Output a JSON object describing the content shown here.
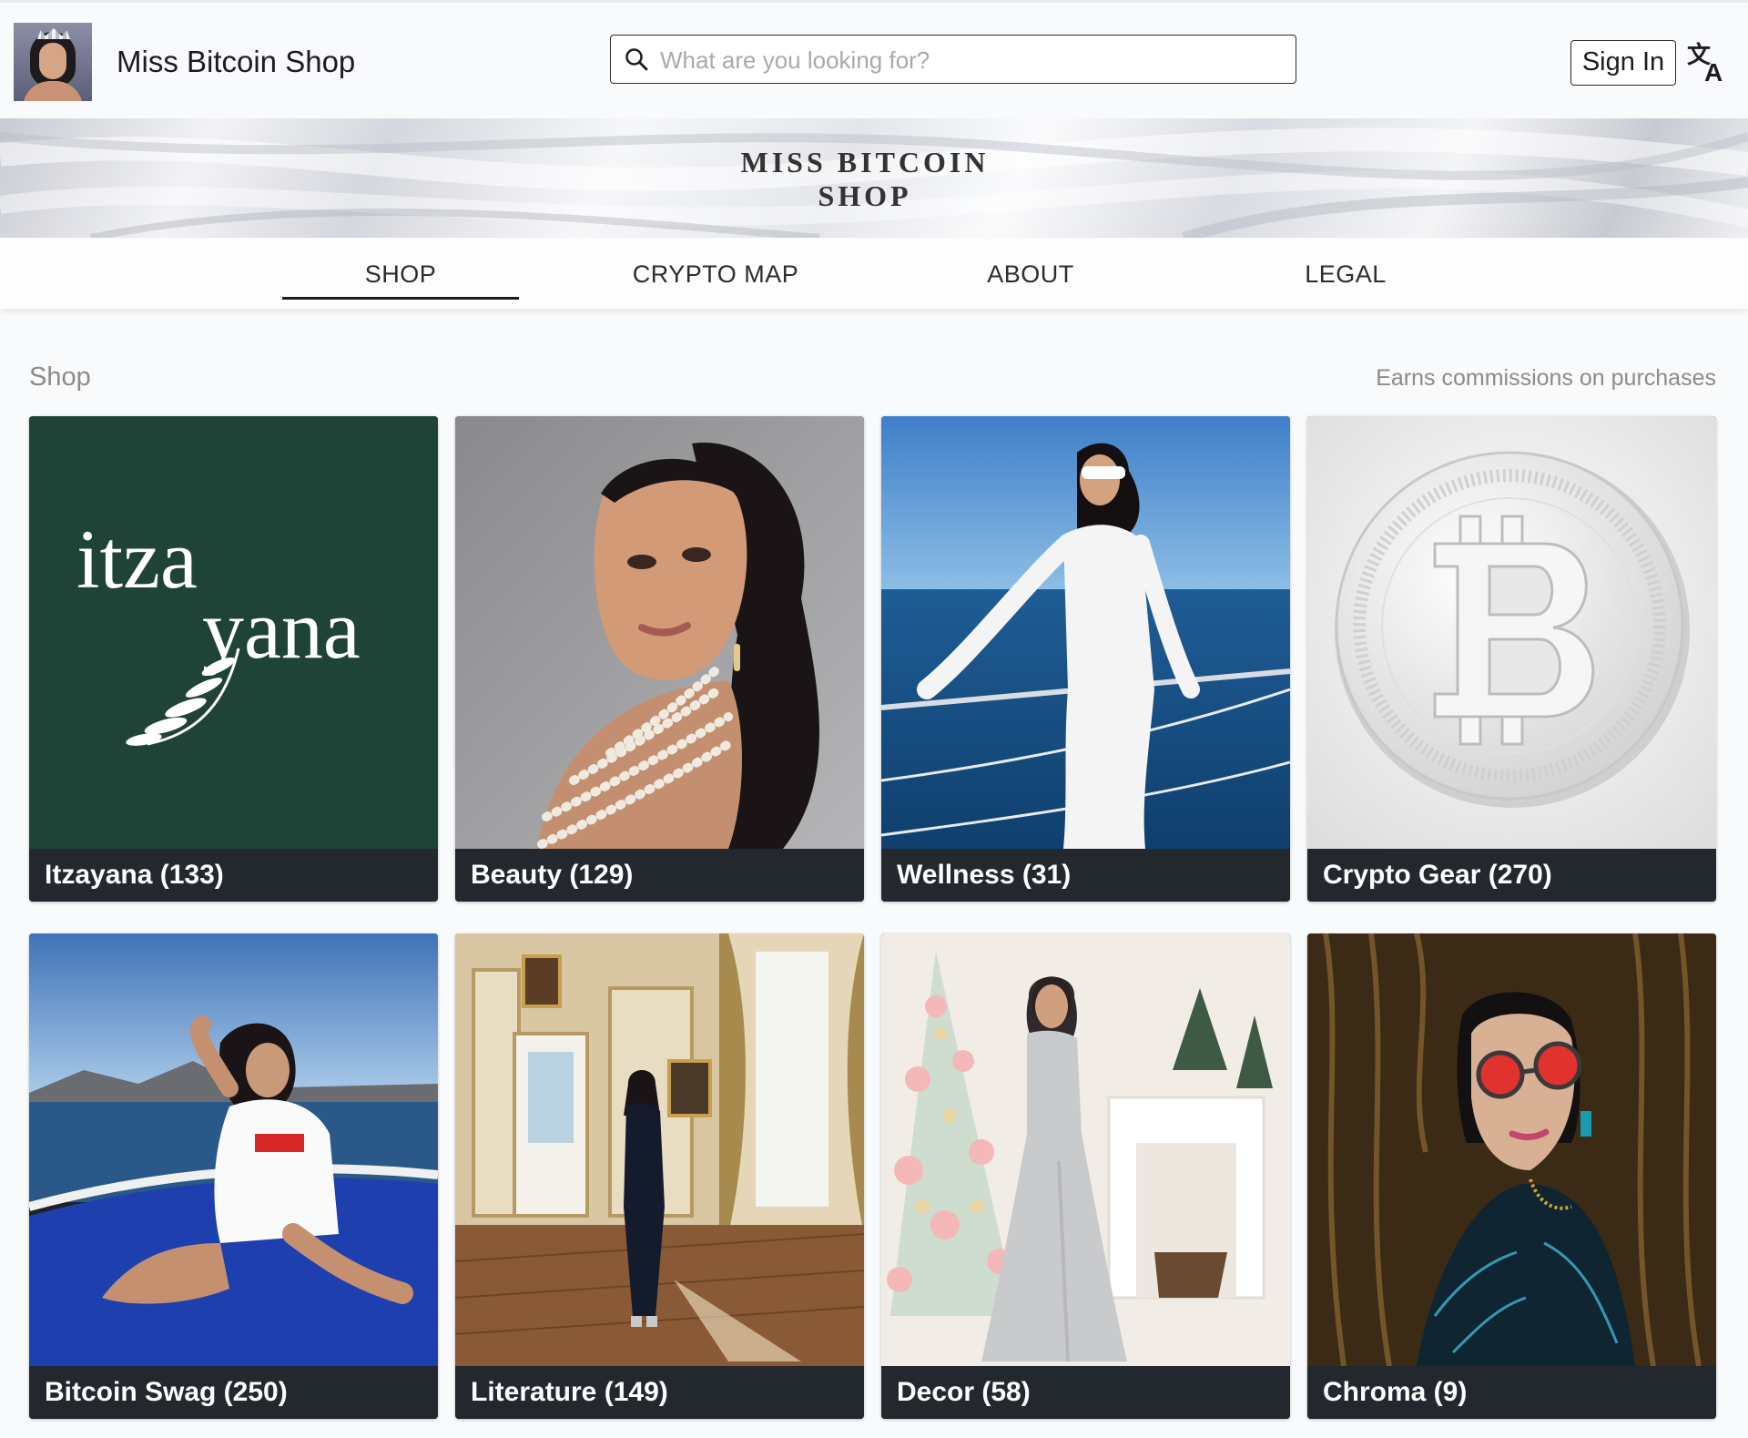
{
  "header": {
    "title": "Miss Bitcoin Shop",
    "search_placeholder": "What are you looking for?",
    "search_value": "",
    "sign_in_label": "Sign In",
    "avatar_icon": "profile-photo",
    "translate_icon": "translate-icon"
  },
  "banner": {
    "line1": "MISS BITCOIN",
    "line2": "SHOP"
  },
  "nav": {
    "items": [
      {
        "label": "SHOP",
        "active": true
      },
      {
        "label": "CRYPTO MAP",
        "active": false
      },
      {
        "label": "ABOUT",
        "active": false
      },
      {
        "label": "LEGAL",
        "active": false
      }
    ]
  },
  "shop": {
    "section_label": "Shop",
    "commission_note": "Earns commissions on purchases",
    "categories": [
      {
        "label": "Itzayana (133)",
        "logo_line1": "itza",
        "logo_line2": "yana"
      },
      {
        "label": "Beauty (129)"
      },
      {
        "label": "Wellness (31)"
      },
      {
        "label": "Crypto Gear (270)"
      },
      {
        "label": "Bitcoin Swag (250)"
      },
      {
        "label": "Literature (149)"
      },
      {
        "label": "Decor (58)"
      },
      {
        "label": "Chroma (9)"
      }
    ]
  },
  "colors": {
    "page_bg": "#f8fafc",
    "caption_bg": "#23272e",
    "brand_green": "#1f4336",
    "muted_text": "#8b8b8b"
  }
}
